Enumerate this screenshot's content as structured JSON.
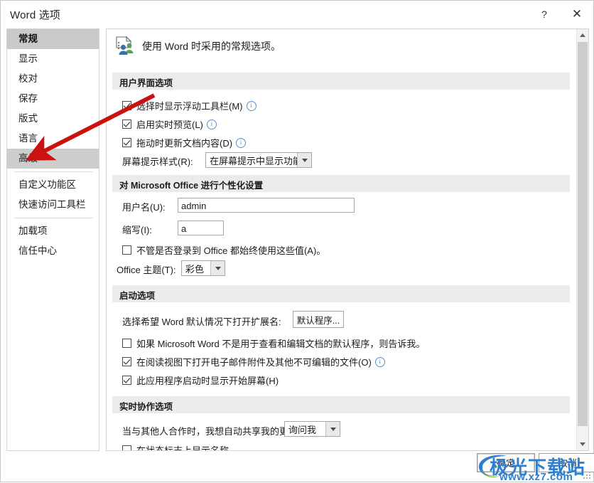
{
  "window": {
    "title": "Word 选项",
    "help_icon": "?",
    "close_icon": "✕"
  },
  "sidebar": {
    "items": [
      {
        "label": "常规",
        "state": "selected"
      },
      {
        "label": "显示",
        "state": "normal"
      },
      {
        "label": "校对",
        "state": "normal"
      },
      {
        "label": "保存",
        "state": "normal"
      },
      {
        "label": "版式",
        "state": "normal"
      },
      {
        "label": "语言",
        "state": "normal"
      },
      {
        "label": "高级",
        "state": "hovered"
      },
      {
        "label": "自定义功能区",
        "state": "normal"
      },
      {
        "label": "快速访问工具栏",
        "state": "normal"
      },
      {
        "label": "加载项",
        "state": "normal"
      },
      {
        "label": "信任中心",
        "state": "normal"
      }
    ]
  },
  "page": {
    "header_text": "使用 Word 时采用的常规选项。",
    "header_icon": "document-people-icon"
  },
  "sections": {
    "ui_options": {
      "title": "用户界面选项",
      "checkbox_float_toolbar": {
        "label": "选择时显示浮动工具栏(M)",
        "accel": "M",
        "checked": true,
        "info": true
      },
      "checkbox_live_preview": {
        "label": "启用实时预览(L)",
        "accel": "L",
        "checked": true,
        "info": true
      },
      "checkbox_update_on_drag": {
        "label": "拖动时更新文档内容(D)",
        "accel": "D",
        "checked": true,
        "info": true
      },
      "screentip_label": "屏幕提示样式(R):",
      "screentip_value": "在屏幕提示中显示功能说明"
    },
    "personalize": {
      "title": "对 Microsoft Office 进行个性化设置",
      "username_label": "用户名(U):",
      "username_value": "admin",
      "initials_label": "缩写(I):",
      "initials_value": "a",
      "always_use_label": "不管是否登录到 Office 都始终使用这些值(A)。",
      "always_use_checked": false,
      "theme_label": "Office 主题(T):",
      "theme_value": "彩色"
    },
    "startup": {
      "title": "启动选项",
      "default_ext_label": "选择希望 Word 默认情况下打开扩展名:",
      "default_program_button": "默认程序...",
      "tell_me_label": "如果 Microsoft Word 不是用于查看和编辑文档的默认程序，则告诉我。",
      "tell_me_checked": false,
      "reading_view_label": "在阅读视图下打开电子邮件附件及其他不可编辑的文件(O)",
      "reading_view_checked": true,
      "start_screen_label": "此应用程序启动时显示开始屏幕(H)",
      "start_screen_checked": true
    },
    "realtime": {
      "title": "实时协作选项",
      "share_label": "当与其他人合作时，我想自动共享我的更改:",
      "share_value": "询问我",
      "show_name_label": "在状态标志上显示名称",
      "show_name_checked": false
    }
  },
  "footer": {
    "ok_label": "确定",
    "cancel_label": "取消"
  },
  "watermark": {
    "line1": "极光下载站",
    "line2": "www.xz7.com"
  },
  "colors": {
    "selected_item": "#c9c9c9",
    "section_header": "#ebebeb",
    "annotation_arrow": "#cc1111",
    "watermark": "#2f7fd0"
  }
}
